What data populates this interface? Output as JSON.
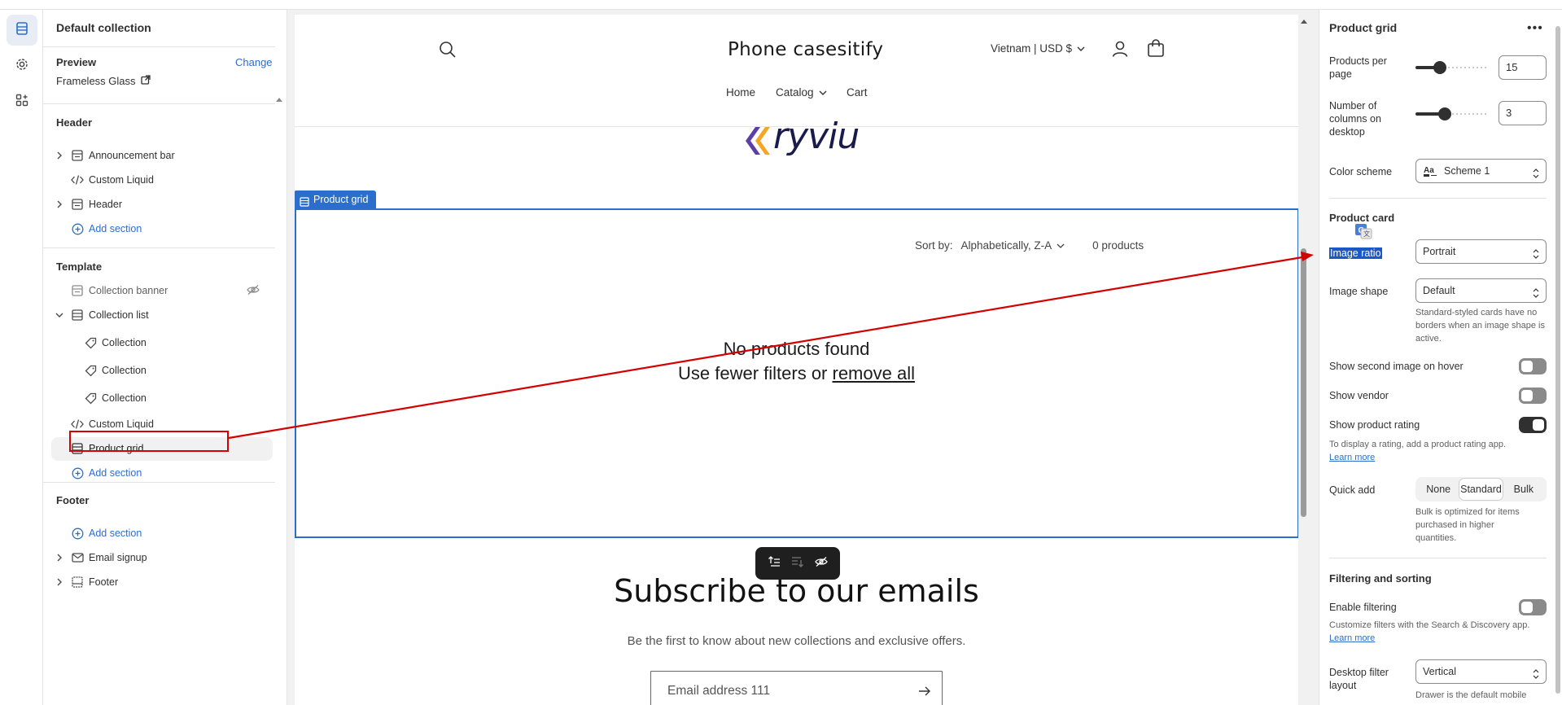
{
  "left_panel": {
    "collection_title": "Default collection",
    "preview_label": "Preview",
    "change_label": "Change",
    "preview_value": "Frameless Glass",
    "header_group": {
      "title": "Header",
      "items": [
        "Announcement bar",
        "Custom Liquid",
        "Header"
      ],
      "add_section": "Add section"
    },
    "template_group": {
      "title": "Template",
      "items": [
        "Collection banner",
        "Collection list",
        "Collection",
        "Collection",
        "Collection",
        "Custom Liquid",
        "Product grid"
      ],
      "add_section": "Add section"
    },
    "footer_group": {
      "title": "Footer",
      "add_section": "Add section",
      "items": [
        "Email signup",
        "Footer"
      ]
    }
  },
  "canvas": {
    "store_name": "Phone casesitify",
    "country": "Vietnam | USD $",
    "nav": [
      "Home",
      "Catalog",
      "Cart"
    ],
    "logo_text": "ryviu",
    "section_tag": "Product grid",
    "sort_label": "Sort by:",
    "sort_value": "Alphabetically, Z-A",
    "product_count": "0 products",
    "empty_title": "No products found",
    "empty_prefix": "Use fewer filters or ",
    "empty_link": "remove all",
    "subscribe_title": "Subscribe to our emails",
    "subscribe_text": "Be the first to know about new collections and exclusive offers.",
    "email_placeholder": "Email address 111"
  },
  "right_panel": {
    "title": "Product grid",
    "products_per_page_label": "Products per page",
    "products_per_page": "15",
    "products_per_page_level": 0.33,
    "columns_label": "Number of columns on desktop",
    "columns": "3",
    "columns_level": 0.4,
    "color_scheme_label": "Color scheme",
    "color_scheme_value": "Scheme 1",
    "product_card_head": "Product card",
    "image_ratio_label": "Image ratio",
    "image_ratio_value": "Portrait",
    "image_shape_label": "Image shape",
    "image_shape_value": "Default",
    "image_shape_help": "Standard-styled cards have no borders when an image shape is active.",
    "second_image_label": "Show second image on hover",
    "second_image_on": false,
    "vendor_label": "Show vendor",
    "vendor_on": false,
    "rating_label": "Show product rating",
    "rating_on": true,
    "rating_help": "To display a rating, add a product rating app.",
    "learn_more": "Learn more",
    "quick_add_label": "Quick add",
    "quick_add_options": [
      "None",
      "Standard",
      "Bulk"
    ],
    "quick_add_selected": "Standard",
    "quick_add_help": "Bulk is optimized for items purchased in higher quantities.",
    "filtering_head": "Filtering and sorting",
    "enable_filtering_label": "Enable filtering",
    "enable_filtering_on": false,
    "filtering_help": "Customize filters with the Search & Discovery app.",
    "learn_more_2": "Learn more",
    "desktop_filter_label": "Desktop filter layout",
    "desktop_filter_value": "Vertical",
    "desktop_filter_help": "Drawer is the default mobile"
  },
  "colors": {
    "accent": "#2c6ecb",
    "annotation_red": "#d40000",
    "logo_purple": "#5b3fa6",
    "logo_orange": "#f5a623"
  }
}
